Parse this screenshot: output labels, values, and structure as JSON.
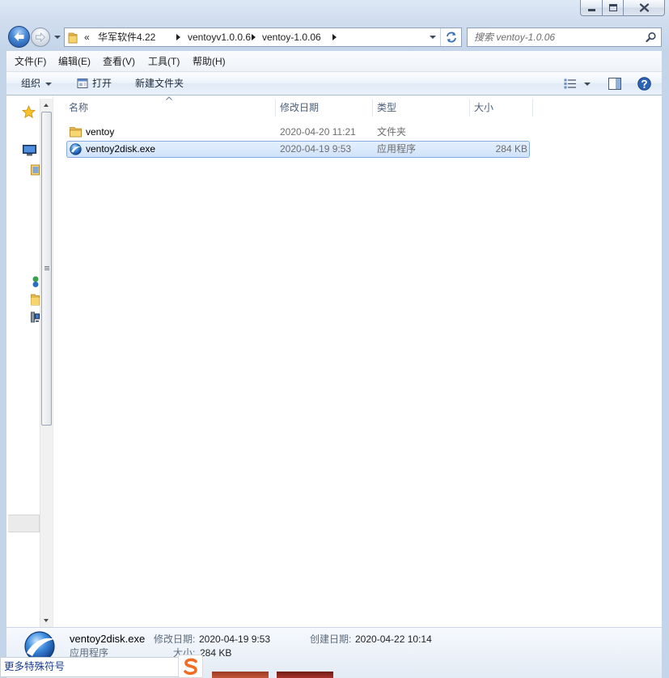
{
  "window": {
    "caption_icons": [
      "minimize-icon",
      "maximize-icon",
      "close-icon"
    ]
  },
  "navigation": {
    "back_icon": "back-arrow-icon",
    "forward_icon": "forward-arrow-icon"
  },
  "address_bar": {
    "overflow": "«",
    "breadcrumbs": [
      "华军软件4.22",
      "ventoyv1.0.0.6",
      "ventoy-1.0.06"
    ],
    "refresh_icon": "refresh-icon"
  },
  "search": {
    "placeholder": "搜索 ventoy-1.0.06",
    "icon": "search-icon"
  },
  "menu": [
    "文件(F)",
    "编辑(E)",
    "查看(V)",
    "工具(T)",
    "帮助(H)"
  ],
  "toolbar": {
    "organize": "组织",
    "open": "打开",
    "new_folder": "新建文件夹",
    "right_icons": [
      "view-options-icon",
      "preview-pane-icon",
      "help-icon"
    ]
  },
  "nav_pane": {
    "icons": [
      "favorites-star-icon",
      "desktop-icon",
      "libraries-icon",
      "homegroup-icon",
      "folder-icon",
      "computer-icon"
    ]
  },
  "columns": {
    "name": "名称",
    "modified": "修改日期",
    "type": "类型",
    "size": "大小",
    "sort_icon": "sort-ascending-icon"
  },
  "files": [
    {
      "name": "ventoy",
      "modified": "2020-04-20 11:21",
      "type": "文件夹",
      "size": "",
      "icon": "folder-icon",
      "selected": false
    },
    {
      "name": "ventoy2disk.exe",
      "modified": "2020-04-19 9:53",
      "type": "应用程序",
      "size": "284 KB",
      "icon": "ventoy-app-icon",
      "selected": true
    }
  ],
  "details": {
    "name": "ventoy2disk.exe",
    "type": "应用程序",
    "modified_label": "修改日期:",
    "modified": "2020-04-19 9:53",
    "created_label": "创建日期:",
    "created": "2020-04-22 10:14",
    "size_label": "大小:",
    "size": "284 KB",
    "icon": "ventoy-app-icon"
  },
  "ime_popup": {
    "label": "更多特殊符号",
    "logo": "sogou-logo-icon"
  },
  "colors": {
    "selection": "#cfe2fa",
    "selection_border": "#84acdd",
    "header_text": "#4c607a",
    "frame": "#c4d5ea"
  }
}
